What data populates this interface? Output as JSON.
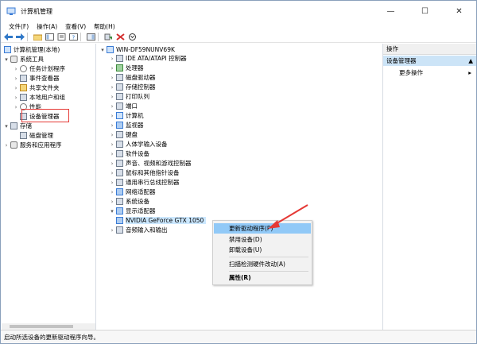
{
  "window": {
    "title": "计算机管理"
  },
  "window_controls": {
    "minimize": "—",
    "maximize": "☐",
    "close": "✕"
  },
  "menu": [
    "文件(F)",
    "操作(A)",
    "查看(V)",
    "帮助(H)"
  ],
  "left_tree": {
    "root": "计算机管理(本地)",
    "system_tools": "系统工具",
    "items": [
      "任务计划程序",
      "事件查看器",
      "共享文件夹",
      "本地用户和组",
      "性能",
      "设备管理器"
    ],
    "storage": "存储",
    "disk_mgmt": "磁盘管理",
    "services": "服务和应用程序"
  },
  "device_tree": {
    "computer": "WIN-DF59NUNV69K",
    "categories": [
      "IDE ATA/ATAPI 控制器",
      "处理器",
      "磁盘驱动器",
      "存储控制器",
      "打印队列",
      "端口",
      "计算机",
      "监视器",
      "键盘",
      "人体学输入设备",
      "软件设备",
      "声音、视频和游戏控制器",
      "鼠标和其他指针设备",
      "通用串行总线控制器",
      "网络适配器",
      "系统设备",
      "显示适配器"
    ],
    "display_child": "NVIDIA GeForce GTX 1050",
    "after": "音频输入和输出"
  },
  "context_menu": {
    "items": [
      "更新驱动程序(P)",
      "禁用设备(D)",
      "卸载设备(U)",
      "扫描检测硬件改动(A)",
      "属性(R)"
    ]
  },
  "actions_pane": {
    "header": "操作",
    "selected": "设备管理器",
    "more": "更多操作"
  },
  "status": "启动所选设备的更新驱动程序向导。",
  "colors": {
    "highlight_box": "#e53935",
    "annotation_arrow": "#e53935",
    "menu_selected": "#91c9f7"
  }
}
